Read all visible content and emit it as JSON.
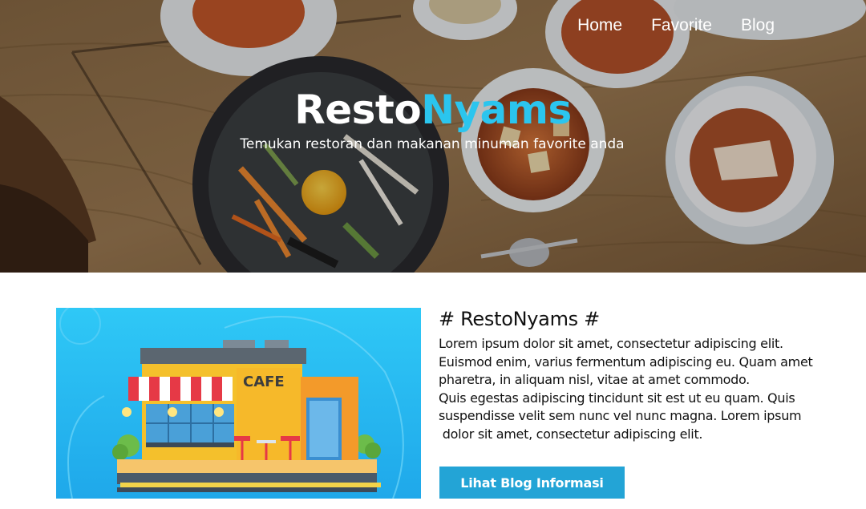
{
  "nav": {
    "items": [
      {
        "label": "Home"
      },
      {
        "label": "Favorite"
      },
      {
        "label": "Blog"
      }
    ]
  },
  "hero": {
    "brand_primary": "Resto",
    "brand_accent": "Nyams",
    "tagline": "Temukan restoran dan makanan minuman favorite anda",
    "accent_color": "#2bc5ee"
  },
  "illustration": {
    "sign_text": "CAFE"
  },
  "info": {
    "heading": "# RestoNyams #",
    "lines": [
      "Lorem ipsum dolor sit amet, consectetur adipiscing elit.",
      "Euismod enim, varius fermentum adipiscing eu. Quam amet",
      "pharetra, in aliquam nisl, vitae at amet commodo.",
      "Quis egestas adipiscing tincidunt sit est ut eu quam. Quis",
      "suspendisse velit sem nunc vel nunc magna. Lorem ipsum",
      " dolor sit amet, consectetur adipiscing elit."
    ],
    "button_label": "Lihat Blog Informasi",
    "button_color": "#23a4d6"
  }
}
